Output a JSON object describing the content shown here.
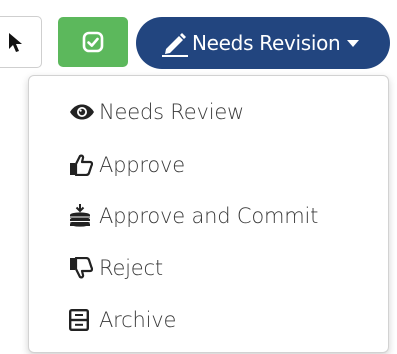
{
  "toolbar": {
    "partial_button_icon": "pointer-icon",
    "check_button_icon": "check-square-icon"
  },
  "status_dropdown": {
    "label": "Needs Revision",
    "icon": "pencil-icon",
    "accent": "#22457f"
  },
  "menu": {
    "items": [
      {
        "label": "Needs Review",
        "icon": "eye-icon"
      },
      {
        "label": "Approve",
        "icon": "thumbs-up-icon"
      },
      {
        "label": "Approve and Commit",
        "icon": "stack-icon"
      },
      {
        "label": "Reject",
        "icon": "thumbs-down-icon"
      },
      {
        "label": "Archive",
        "icon": "archive-icon"
      }
    ]
  },
  "colors": {
    "approve_green": "#5cb85c",
    "status_blue": "#22457f",
    "menu_text": "#3a3a3a"
  }
}
